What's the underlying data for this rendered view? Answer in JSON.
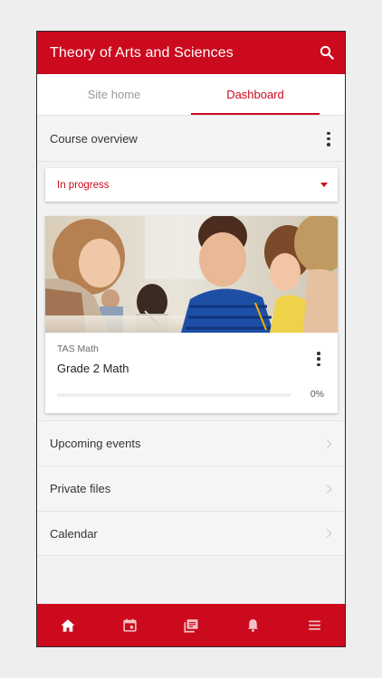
{
  "app": {
    "title": "Theory of Arts and Sciences",
    "accent_color": "#cc0a1e"
  },
  "tabs": [
    {
      "label": "Site home",
      "active": false
    },
    {
      "label": "Dashboard",
      "active": true
    }
  ],
  "overview": {
    "title": "Course overview",
    "menu_icon": "kebab-menu-icon"
  },
  "filter": {
    "selected": "In progress",
    "icon": "dropdown-caret-icon"
  },
  "course": {
    "image": "classroom-photo",
    "category": "TAS Math",
    "name": "Grade 2 Math",
    "progress_percent": 0,
    "progress_text": "0%"
  },
  "list": [
    {
      "label": "Upcoming events",
      "icon": "chevron-right-icon"
    },
    {
      "label": "Private files",
      "icon": "chevron-right-icon"
    },
    {
      "label": "Calendar",
      "icon": "chevron-right-icon"
    }
  ],
  "bottom_nav": [
    {
      "icon": "home-icon",
      "active": true
    },
    {
      "icon": "calendar-icon",
      "active": false
    },
    {
      "icon": "messages-icon",
      "active": false
    },
    {
      "icon": "bell-icon",
      "active": false
    },
    {
      "icon": "menu-icon",
      "active": false
    }
  ]
}
